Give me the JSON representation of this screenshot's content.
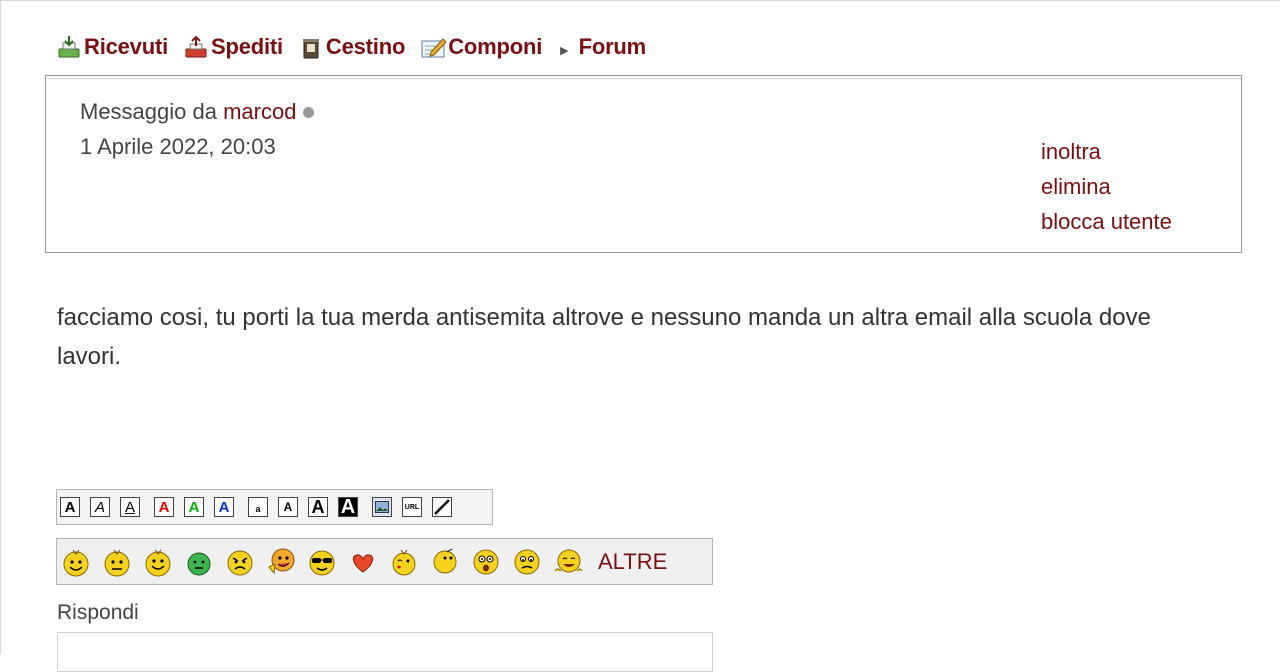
{
  "nav": {
    "items": [
      {
        "label": "Ricevuti",
        "icon": "inbox-tray-icon"
      },
      {
        "label": "Spediti",
        "icon": "outbox-tray-icon"
      },
      {
        "label": "Cestino",
        "icon": "trash-bin-icon"
      },
      {
        "label": "Componi",
        "icon": "compose-icon"
      },
      {
        "label": "Forum",
        "icon": "arrow-right-icon"
      }
    ]
  },
  "message": {
    "from_prefix": "Messaggio da",
    "sender": "marcod",
    "date": "1 Aprile 2022, 20:03",
    "actions": [
      "inoltra",
      "elimina",
      "blocca utente"
    ],
    "body": "facciamo cosi, tu porti la tua merda antisemita altrove e nessuno manda un altra email alla scuola dove lavori."
  },
  "format_toolbar": {
    "buttons": [
      {
        "name": "bold-button",
        "glyph": "A"
      },
      {
        "name": "italic-button",
        "glyph": "A"
      },
      {
        "name": "underline-button",
        "glyph": "A"
      },
      {
        "name": "red-text-button",
        "glyph": "A",
        "color": "#e00000"
      },
      {
        "name": "green-text-button",
        "glyph": "A",
        "color": "#00b000"
      },
      {
        "name": "blue-text-button",
        "glyph": "A",
        "color": "#0030e0"
      },
      {
        "name": "small-text-button",
        "glyph": "a"
      },
      {
        "name": "normal-text-button",
        "glyph": "A"
      },
      {
        "name": "large-text-button",
        "glyph": "A"
      },
      {
        "name": "xlarge-text-button",
        "glyph": "A"
      },
      {
        "name": "image-button",
        "icon": "image-icon"
      },
      {
        "name": "url-button",
        "glyph": "URL"
      },
      {
        "name": "clear-format-button",
        "icon": "slash-icon"
      }
    ]
  },
  "smileys": {
    "icons": [
      "smiley-happy-icon",
      "smiley-grumpy-icon",
      "smiley-smile-icon",
      "smiley-green-icon",
      "smiley-angry-icon",
      "smiley-tongue-icon",
      "smiley-sunglasses-icon",
      "heart-icon",
      "smiley-kiss-icon",
      "smiley-thinking-icon",
      "smiley-shocked-icon",
      "smiley-sad-icon",
      "smiley-laughing-icon"
    ],
    "more_label": "ALTRE"
  },
  "reply": {
    "label": "Rispondi"
  },
  "colors": {
    "accent": "#7a0f0f",
    "text": "#333333",
    "border": "#9a9a9a"
  }
}
